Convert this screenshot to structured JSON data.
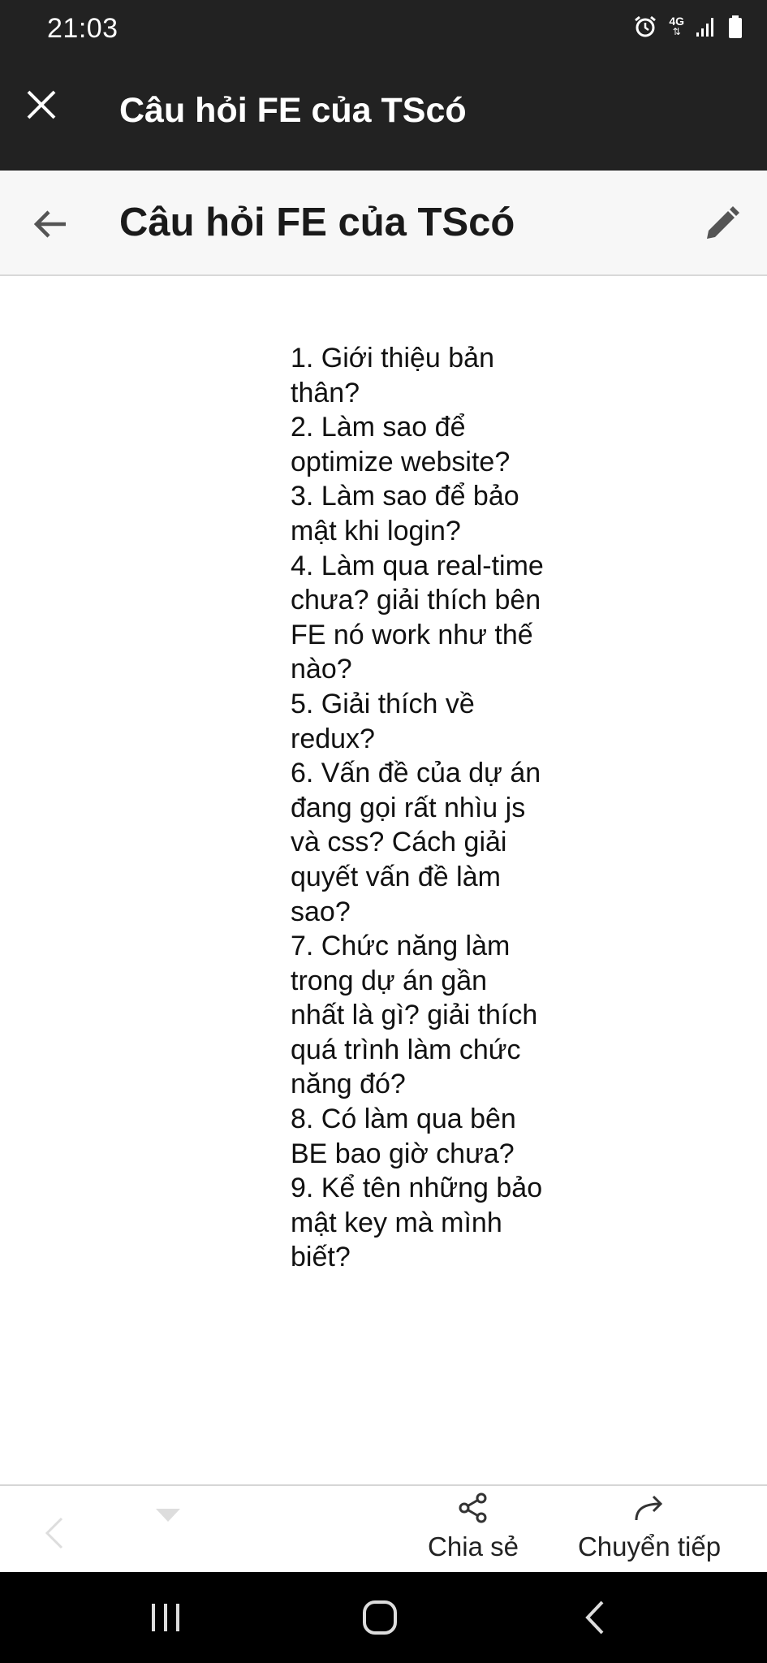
{
  "status_bar": {
    "time": "21:03",
    "network": "4G",
    "icons": [
      "alarm-icon",
      "network-4g-icon",
      "signal-icon",
      "battery-icon"
    ]
  },
  "app_bar": {
    "title": "Câu hỏi FE của TScó",
    "close_icon": "close-icon"
  },
  "sub_bar": {
    "title": "Câu hỏi FE của TScó",
    "back_icon": "back-arrow-icon",
    "edit_icon": "pencil-icon"
  },
  "content": {
    "lines": [
      "1. Giới thiệu bản",
      "thân?",
      "2. Làm sao để",
      "optimize website?",
      "3. Làm sao để bảo",
      "mật khi login?",
      "4. Làm qua real-time",
      "chưa? giải thích bên",
      "FE nó work như thế",
      "nào?",
      "5. Giải thích về",
      "redux?",
      "6. Vấn đề của dự án",
      "đang gọi rất nhìu js",
      "và css? Cách giải",
      "quyết vấn đề làm",
      "sao?",
      "7. Chức năng làm",
      "trong dự án gần",
      "nhất là gì? giải thích",
      "quá trình làm chức",
      "năng đó?",
      "8. Có làm qua bên",
      "BE bao giờ chưa?",
      "9. Kể tên những bảo",
      "mật key mà mình",
      "biết?"
    ]
  },
  "toolbar": {
    "share_label": "Chia sẻ",
    "forward_label": "Chuyển tiếp"
  },
  "colors": {
    "dark_bar": "#222222",
    "sub_bar": "#f7f7f7",
    "text": "#111111",
    "icon_gray": "#555555"
  }
}
